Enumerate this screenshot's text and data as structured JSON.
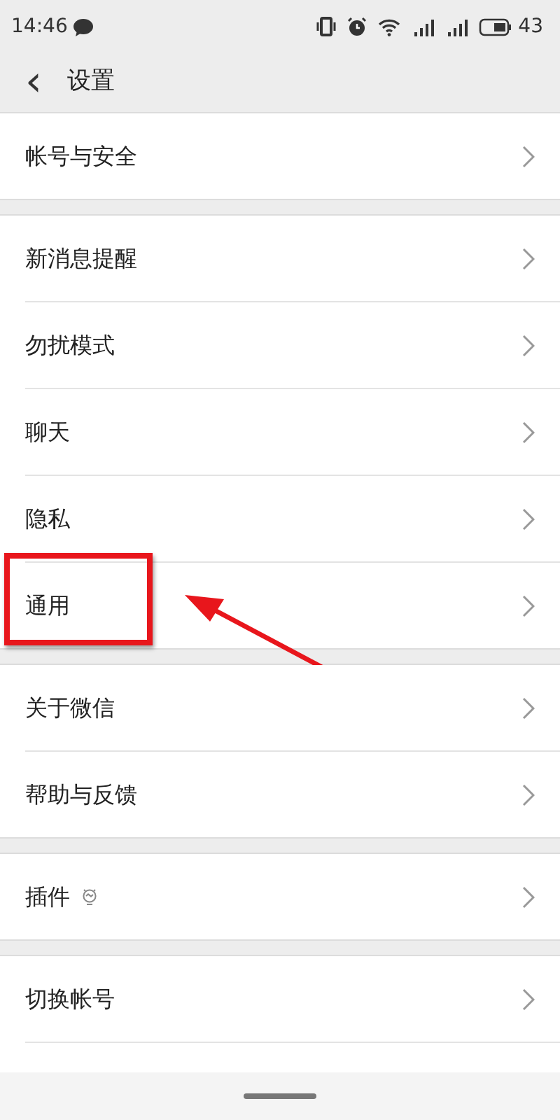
{
  "status_bar": {
    "time": "14:46",
    "battery_percent": "43"
  },
  "header": {
    "back": "‹",
    "title": "设置"
  },
  "groups": [
    {
      "items": [
        {
          "label": "帐号与安全",
          "kind": "plain",
          "annotated": false
        }
      ]
    },
    {
      "items": [
        {
          "label": "新消息提醒",
          "kind": "plain",
          "annotated": false
        },
        {
          "label": "勿扰模式",
          "kind": "plain",
          "annotated": false
        },
        {
          "label": "聊天",
          "kind": "plain",
          "annotated": false
        },
        {
          "label": "隐私",
          "kind": "plain",
          "annotated": false
        },
        {
          "label": "通用",
          "kind": "plain",
          "annotated": true
        }
      ]
    },
    {
      "items": [
        {
          "label": "关于微信",
          "kind": "plain",
          "annotated": false
        },
        {
          "label": "帮助与反馈",
          "kind": "plain",
          "annotated": false
        }
      ]
    },
    {
      "items": [
        {
          "label": "插件",
          "kind": "with-icon",
          "annotated": false
        }
      ]
    },
    {
      "items": [
        {
          "label": "切换帐号",
          "kind": "plain",
          "annotated": false
        },
        {
          "kind": "cut"
        }
      ]
    }
  ]
}
